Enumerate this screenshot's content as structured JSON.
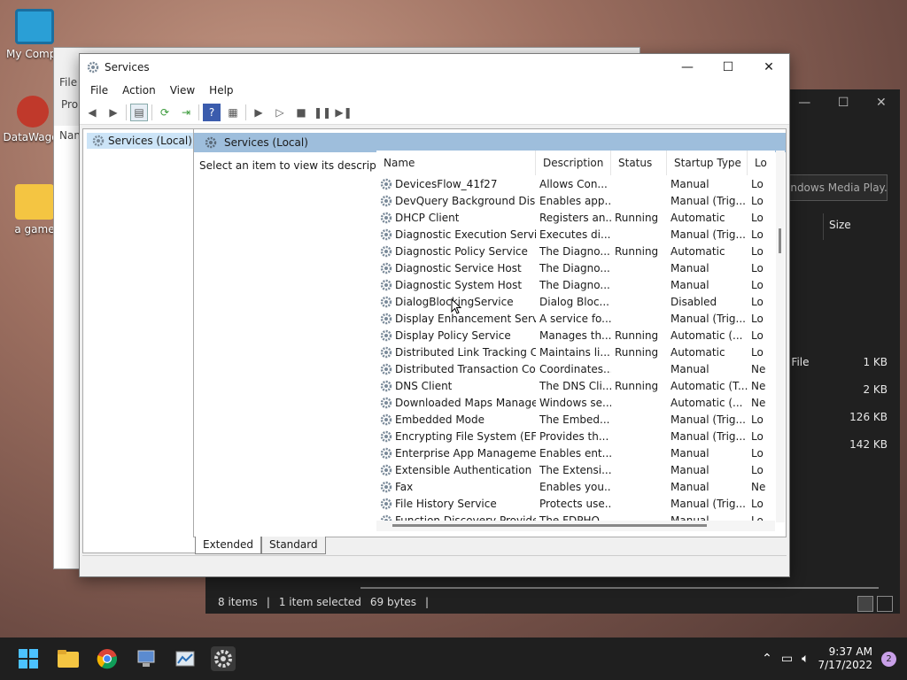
{
  "desktop": {
    "icons": [
      {
        "label": "My Compu"
      },
      {
        "label": "DataWagor"
      },
      {
        "label": "a game"
      }
    ]
  },
  "explorer_window": {
    "search_placeholder": "indows Media Play...",
    "size_header": "Size",
    "files": [
      {
        "name": "n File",
        "size": "1 KB"
      },
      {
        "name": "",
        "size": "2 KB"
      },
      {
        "name": "",
        "size": "126 KB"
      },
      {
        "name": "",
        "size": "142 KB"
      }
    ],
    "status": {
      "items": "8 items",
      "selected": "1 item selected",
      "bytes": "69 bytes"
    }
  },
  "behind_window": {
    "menu_file": "File",
    "tab": "Pro",
    "col": "Nan"
  },
  "services": {
    "title": "Services",
    "menu": [
      "File",
      "Action",
      "View",
      "Help"
    ],
    "tree_node": "Services (Local)",
    "pane_title": "Services (Local)",
    "description_prompt": "Select an item to view its description.",
    "columns": {
      "name": "Name",
      "description": "Description",
      "status": "Status",
      "startup": "Startup Type",
      "logon": "Lo"
    },
    "rows": [
      {
        "name": "DevicesFlow_41f27",
        "desc": "Allows Con...",
        "status": "",
        "startup": "Manual",
        "logon": "Lo"
      },
      {
        "name": "DevQuery Background Disc...",
        "desc": "Enables app...",
        "status": "",
        "startup": "Manual (Trig...",
        "logon": "Lo"
      },
      {
        "name": "DHCP Client",
        "desc": "Registers an...",
        "status": "Running",
        "startup": "Automatic",
        "logon": "Lo"
      },
      {
        "name": "Diagnostic Execution Service",
        "desc": "Executes di...",
        "status": "",
        "startup": "Manual (Trig...",
        "logon": "Lo"
      },
      {
        "name": "Diagnostic Policy Service",
        "desc": "The Diagno...",
        "status": "Running",
        "startup": "Automatic",
        "logon": "Lo"
      },
      {
        "name": "Diagnostic Service Host",
        "desc": "The Diagno...",
        "status": "",
        "startup": "Manual",
        "logon": "Lo"
      },
      {
        "name": "Diagnostic System Host",
        "desc": "The Diagno...",
        "status": "",
        "startup": "Manual",
        "logon": "Lo"
      },
      {
        "name": "DialogBlockingService",
        "desc": "Dialog Bloc...",
        "status": "",
        "startup": "Disabled",
        "logon": "Lo"
      },
      {
        "name": "Display Enhancement Service",
        "desc": "A service fo...",
        "status": "",
        "startup": "Manual (Trig...",
        "logon": "Lo"
      },
      {
        "name": "Display Policy Service",
        "desc": "Manages th...",
        "status": "Running",
        "startup": "Automatic (...",
        "logon": "Lo"
      },
      {
        "name": "Distributed Link Tracking Cli...",
        "desc": "Maintains li...",
        "status": "Running",
        "startup": "Automatic",
        "logon": "Lo"
      },
      {
        "name": "Distributed Transaction Coo...",
        "desc": "Coordinates...",
        "status": "",
        "startup": "Manual",
        "logon": "Ne"
      },
      {
        "name": "DNS Client",
        "desc": "The DNS Cli...",
        "status": "Running",
        "startup": "Automatic (T...",
        "logon": "Ne"
      },
      {
        "name": "Downloaded Maps Manager",
        "desc": "Windows se...",
        "status": "",
        "startup": "Automatic (...",
        "logon": "Ne"
      },
      {
        "name": "Embedded Mode",
        "desc": "The Embed...",
        "status": "",
        "startup": "Manual (Trig...",
        "logon": "Lo"
      },
      {
        "name": "Encrypting File System (EFS)",
        "desc": "Provides th...",
        "status": "",
        "startup": "Manual (Trig...",
        "logon": "Lo"
      },
      {
        "name": "Enterprise App Managemen...",
        "desc": "Enables ent...",
        "status": "",
        "startup": "Manual",
        "logon": "Lo"
      },
      {
        "name": "Extensible Authentication P...",
        "desc": "The Extensi...",
        "status": "",
        "startup": "Manual",
        "logon": "Lo"
      },
      {
        "name": "Fax",
        "desc": "Enables you...",
        "status": "",
        "startup": "Manual",
        "logon": "Ne"
      },
      {
        "name": "File History Service",
        "desc": "Protects use...",
        "status": "",
        "startup": "Manual (Trig...",
        "logon": "Lo"
      },
      {
        "name": "Function Discovery Provide...",
        "desc": "The FDPHO...",
        "status": "",
        "startup": "Manual",
        "logon": "Lo"
      }
    ],
    "tabs": [
      "Extended",
      "Standard"
    ]
  },
  "taskbar": {
    "time": "9:37 AM",
    "date": "7/17/2022",
    "notifications": "2"
  },
  "colors": {
    "selection": "#cce4f7",
    "pane_header": "#9ebedc",
    "taskbar": "#1f1f1f"
  }
}
